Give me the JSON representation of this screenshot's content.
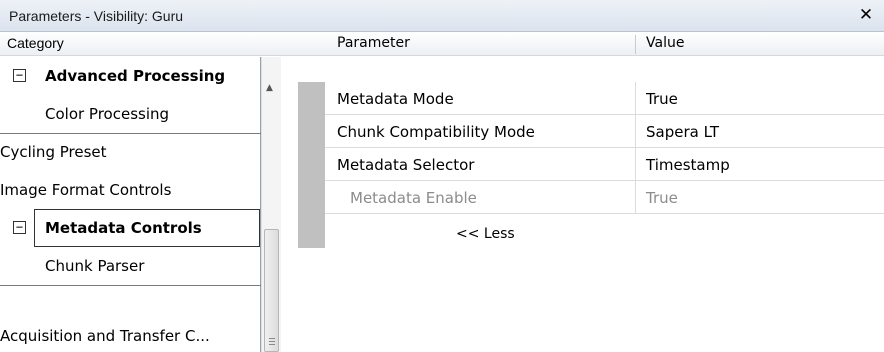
{
  "window": {
    "title": "Parameters - Visibility: Guru",
    "close_icon": "close-icon",
    "close_glyph": "✕"
  },
  "header": {
    "category": "Category",
    "parameter": "Parameter",
    "value": "Value"
  },
  "categories": [
    {
      "label": "Advanced Processing",
      "expander": "⊟",
      "bold": true
    },
    {
      "label": "Color Processing"
    },
    {
      "label": "Cycling Preset"
    },
    {
      "label": "Image Format Controls"
    },
    {
      "label": "Metadata Controls",
      "expander": "⊟",
      "bold": true,
      "selected": true
    },
    {
      "label": "Chunk Parser"
    },
    {
      "label": "Acquisition and Transfer C..."
    }
  ],
  "parameters": [
    {
      "name": "Metadata Mode",
      "value": "True",
      "enabled": true
    },
    {
      "name": "Chunk Compatibility Mode",
      "value": "Sapera LT",
      "enabled": true
    },
    {
      "name": "Metadata Selector",
      "value": "Timestamp",
      "enabled": true
    },
    {
      "name": "Metadata Enable",
      "value": "True",
      "enabled": false
    }
  ],
  "less_link": "<< Less",
  "scroll_up_glyph": "▲"
}
